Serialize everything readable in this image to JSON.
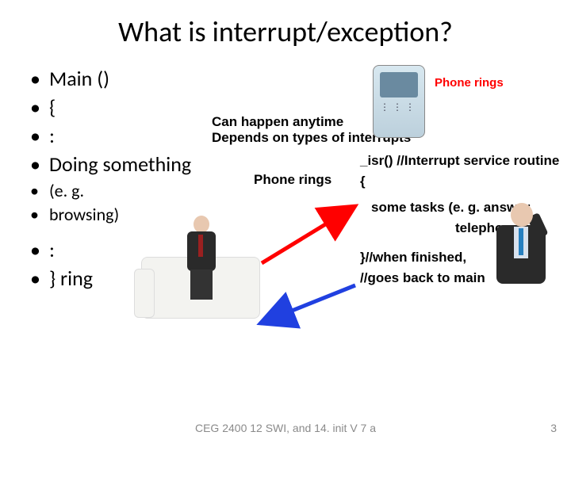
{
  "title": "What is interrupt/exception?",
  "bullets": {
    "b1": "Main ()",
    "b2": "{",
    "b3": ":",
    "b4": "Doing something",
    "b5": "(e. g.",
    "b6": "browsing)",
    "b7": ":",
    "b8": "} ring"
  },
  "annot": {
    "line1": "Can happen anytime",
    "line2": "Depends on types of interrupts"
  },
  "phone_rings_center": "Phone rings",
  "phone_rings_top": "Phone rings",
  "isr": {
    "l1": "_isr() //Interrupt service routine",
    "l2": "{",
    "l3": "some tasks (e. g. answer",
    "l4": "telephone)",
    "l5": "}//when finished,",
    "l6": "//goes back to main"
  },
  "footer": {
    "center": "CEG 2400 12 SWI, and 14. init V 7 a",
    "page": "3"
  }
}
